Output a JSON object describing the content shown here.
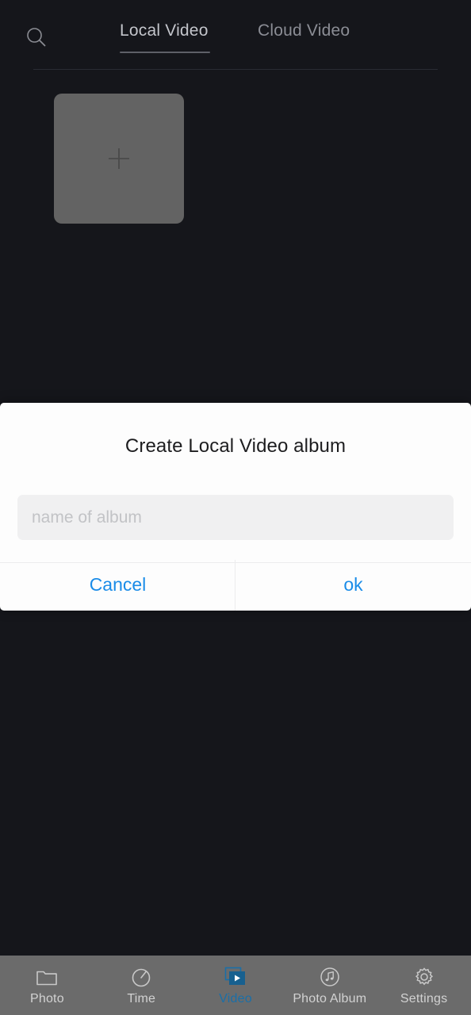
{
  "app": {
    "background_color": "#15161b",
    "accent_color": "#1a8ce8",
    "nav_active_color": "#1a6fa8"
  },
  "header": {
    "search_icon": "search-icon",
    "tabs": [
      {
        "label": "Local Video",
        "active": true
      },
      {
        "label": "Cloud Video",
        "active": false
      }
    ]
  },
  "content": {
    "add_tile": {
      "icon": "plus-icon",
      "tile_color": "#636363"
    }
  },
  "dialog": {
    "title": "Create Local Video album",
    "input": {
      "value": "",
      "placeholder": "name of album"
    },
    "buttons": [
      {
        "label": "Cancel",
        "name": "cancel-button"
      },
      {
        "label": "ok",
        "name": "ok-button"
      }
    ]
  },
  "bottom_nav": {
    "items": [
      {
        "label": "Photo",
        "icon": "folder-icon",
        "active": false
      },
      {
        "label": "Time",
        "icon": "stopwatch-icon",
        "active": false
      },
      {
        "label": "Video",
        "icon": "video-icon",
        "active": true
      },
      {
        "label": "Photo Album",
        "icon": "music-note-circle-icon",
        "active": false
      },
      {
        "label": "Settings",
        "icon": "gear-icon",
        "active": false
      }
    ]
  }
}
